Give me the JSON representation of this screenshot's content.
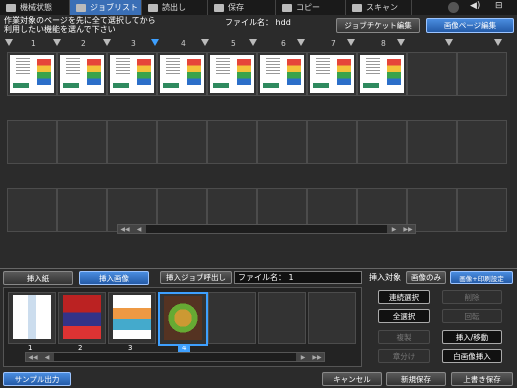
{
  "top_tabs": [
    {
      "label": "機械状態",
      "icon": "machine-icon",
      "active": false
    },
    {
      "label": "ジョブリスト",
      "icon": "job-list-icon",
      "active": true
    },
    {
      "label": "読出し",
      "icon": "read-icon",
      "active": false
    },
    {
      "label": "保存",
      "icon": "save-icon",
      "active": false
    },
    {
      "label": "コピー",
      "icon": "copy-icon",
      "active": false
    },
    {
      "label": "スキャン",
      "icon": "scan-icon",
      "active": false
    }
  ],
  "instruction_line1": "作業対象のページを先に全て選択してから",
  "instruction_line2": "利用したい機能を選んで下さい",
  "file_label": "ファイル名：",
  "file_value": "hdd",
  "mode_tabs": {
    "job_ticket": "ジョブチケット編集",
    "image_page": "画像ページ編集"
  },
  "page_numbers": [
    "1",
    "2",
    "3",
    "4",
    "5",
    "6",
    "7",
    "8"
  ],
  "selected_page": "4",
  "insert_tabs": {
    "insert_paper": "挿入紙",
    "insert_image": "挿入画像"
  },
  "insert_job_call": "挿入ジョブ呼出し",
  "insert_file_label": "ファイル名：",
  "insert_file_value": "1",
  "insert_target_label": "挿入対象",
  "target_options": {
    "image_only": "画像のみ",
    "image_and_settings": "画像+印刷設定"
  },
  "lower_numbers": [
    "1",
    "2",
    "3",
    "4"
  ],
  "lower_selected": "4",
  "right_buttons": {
    "continuous_select": "連続選択",
    "delete": "削除",
    "select_all": "全選択",
    "rotate": "回転",
    "duplicate": "複製",
    "insert_move": "挿入/移動",
    "chapter": "章分け",
    "blank_insert": "白画像挿入"
  },
  "footer": {
    "sample_output": "サンプル出力",
    "cancel": "キャンセル",
    "new_save": "新規保存",
    "overwrite_save": "上書き保存"
  },
  "colors": {
    "accent": "#3a6fb6",
    "selected": "#3ea0ff"
  }
}
